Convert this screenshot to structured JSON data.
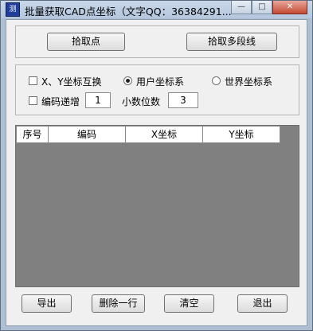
{
  "window": {
    "title": "批量获取CAD点坐标（文字QQ：36384291...",
    "icon": "app-icon",
    "caption": {
      "minimize": "—",
      "maximize": "□",
      "close": "✕"
    }
  },
  "pick": {
    "point_label": "拾取点",
    "polyline_label": "拾取多段线"
  },
  "options": {
    "swap_xy_label": "X、Y坐标互换",
    "swap_xy_checked": false,
    "user_cs_label": "用户坐标系",
    "user_cs_selected": true,
    "world_cs_label": "世界坐标系",
    "world_cs_selected": false,
    "code_increment_label": "编码递增",
    "code_increment_checked": false,
    "code_increment_value": "1",
    "decimals_label": "小数位数",
    "decimals_value": "3"
  },
  "table": {
    "columns": [
      "序号",
      "编码",
      "X坐标",
      "Y坐标"
    ],
    "rows": []
  },
  "footer": {
    "export_label": "导出",
    "delete_row_label": "删除一行",
    "clear_label": "清空",
    "exit_label": "退出"
  }
}
